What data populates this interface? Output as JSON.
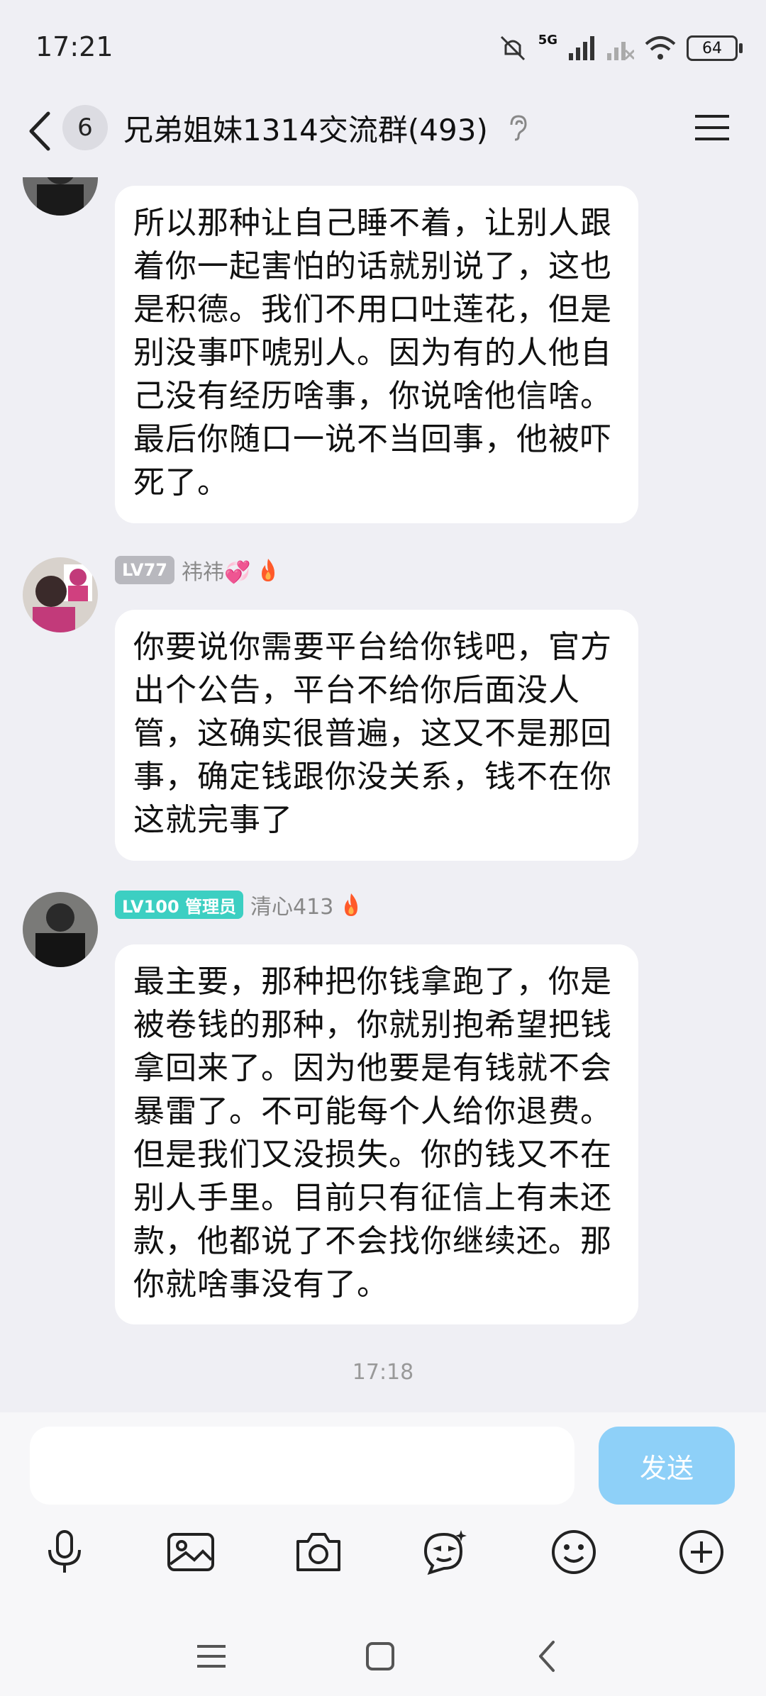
{
  "status_bar": {
    "time": "17:21",
    "network": "5G",
    "battery": "64"
  },
  "header": {
    "unread_count": "6",
    "title": "兄弟姐妹1314交流群(493)"
  },
  "messages": [
    {
      "text": "所以那种让自己睡不着，让别人跟着你一起害怕的话就别说了，这也是积德。我们不用口吐莲花，但是别没事吓唬别人。因为有的人他自己没有经历啥事，你说啥他信啥。最后你随口一说不当回事，他被吓死了。"
    },
    {
      "level": "LV77",
      "sender": "祎祎💞",
      "text": "你要说你需要平台给你钱吧，官方出个公告，平台不给你后面没人管，这确实很普遍，这又不是那回事，确定钱跟你没关系，钱不在你这就完事了"
    },
    {
      "level": "LV100 管理员",
      "sender": "清心413",
      "text": "最主要，那种把你钱拿跑了，你是被卷钱的那种，你就别抱希望把钱拿回来了。因为他要是有钱就不会暴雷了。不可能每个人给你退费。但是我们又没损失。你的钱又不在别人手里。目前只有征信上有未还款，他都说了不会找你继续还。那你就啥事没有了。"
    }
  ],
  "timestamp": "17:18",
  "composer": {
    "placeholder": "",
    "send_label": "发送"
  },
  "colors": {
    "background": "#efeff4",
    "bubble": "#ffffff",
    "send_button": "#8ed0f8",
    "admin_badge": "#3ccfc2",
    "level_badge": "#b8b8be",
    "flame": "#ff5a2a"
  }
}
